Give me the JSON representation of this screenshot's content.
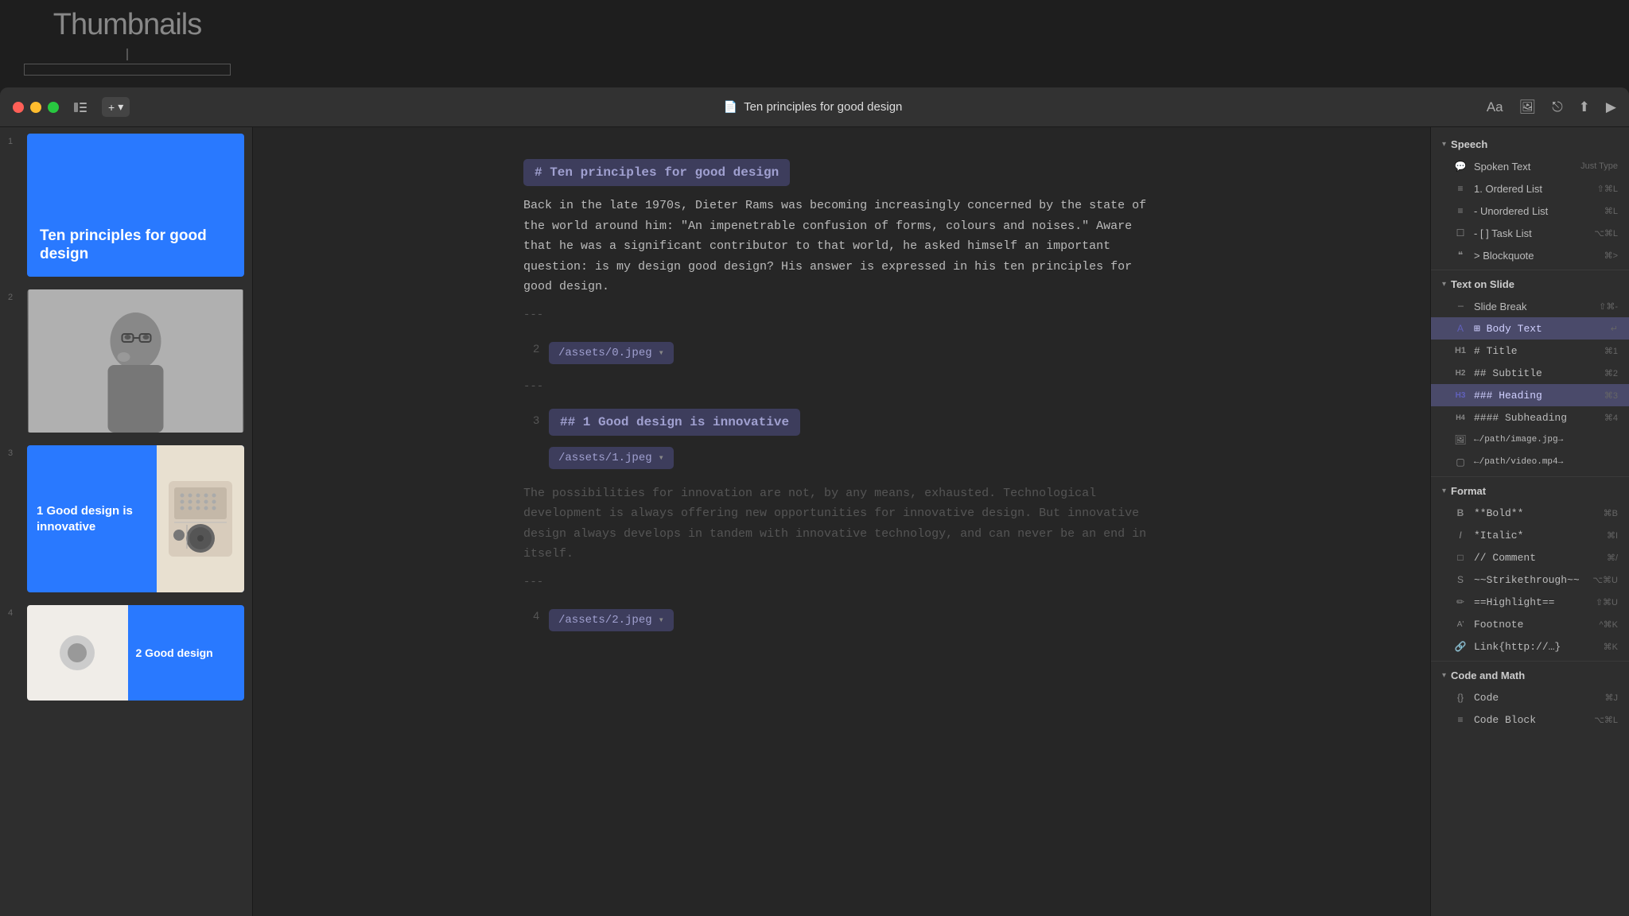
{
  "app": {
    "title": "Ten principles for good design",
    "thumbnails_label": "Thumbnails"
  },
  "titlebar": {
    "doc_icon": "📄",
    "doc_title": "Ten principles for good design",
    "add_label": "+",
    "aa_label": "Aa"
  },
  "slides": [
    {
      "num": "1",
      "title": "Ten principles for good design",
      "bg": "#2979ff"
    },
    {
      "num": "2",
      "type": "photo"
    },
    {
      "num": "3",
      "title": "1 Good design is innovative",
      "bg": "#2979ff"
    },
    {
      "num": "4",
      "title": "2 Good design",
      "bg": "#2979ff"
    }
  ],
  "editor": {
    "heading_block": "# Ten principles for good design",
    "intro_text": "Back in the late 1970s, Dieter Rams was becoming increasingly concerned by the state of the world around him: \"An impenetrable confusion of forms, colours and noises.\" Aware that he was a significant contributor to that world, he asked himself an important question: is my design good design? His answer is expressed in his ten principles for good design.",
    "sep1": "---",
    "slide2_num": "2",
    "asset1": "/assets/0.jpeg",
    "sep2": "---",
    "slide3_num": "3",
    "slide3_heading": "## 1 Good design is innovative",
    "asset2": "/assets/1.jpeg",
    "slide3_body": "The possibilities for innovation are not, by any means, exhausted. Technological development is always offering new opportunities for innovative design. But innovative design always develops in tandem with innovative technology, and can never be an end in itself.",
    "sep3": "---",
    "slide4_num": "4",
    "asset3": "/assets/2.jpeg"
  },
  "right_panel": {
    "speech_section": "Speech",
    "spoken_text_label": "Spoken Text",
    "spoken_text_right": "Just Type",
    "ordered_list_label": "1. Ordered List",
    "ordered_list_shortcut": "⇧⌘L",
    "unordered_list_label": "- Unordered List",
    "unordered_list_shortcut": "⌘L",
    "task_list_label": "- [ ] Task List",
    "task_list_shortcut": "⌥⌘L",
    "blockquote_label": "> Blockquote",
    "blockquote_shortcut": "⌘>",
    "text_on_slide_section": "Text on Slide",
    "slide_break_label": "Slide Break",
    "slide_break_shortcut": "⇧⌘-",
    "body_text_label": "Body Text",
    "body_text_shortcut": "↵",
    "title_label": "# Title",
    "title_shortcut": "⌘1",
    "subtitle_label": "## Subtitle",
    "subtitle_shortcut": "⌘2",
    "heading_label": "### Heading",
    "heading_shortcut": "⌘3",
    "subheading_label": "#### Subheading",
    "subheading_shortcut": "⌘4",
    "image_label": "←/path/image.jpg→",
    "video_label": "←/path/video.mp4→",
    "format_section": "Format",
    "bold_label": "**Bold**",
    "bold_shortcut": "⌘B",
    "italic_label": "*Italic*",
    "italic_shortcut": "⌘I",
    "comment_label": "// Comment",
    "comment_shortcut": "⌘/",
    "strikethrough_label": "~~Strikethrough~~",
    "strikethrough_shortcut": "⌥⌘U",
    "highlight_label": "==Highlight==",
    "highlight_shortcut": "⇧⌘U",
    "footnote_label": "Footnote",
    "footnote_shortcut": "^⌘K",
    "link_label": "Link{http://…}",
    "link_shortcut": "⌘K",
    "code_math_section": "Code and Math",
    "code_label": "Code",
    "code_shortcut": "⌘J",
    "code_block_label": "Code Block",
    "code_block_shortcut": "⌥⌘L"
  }
}
